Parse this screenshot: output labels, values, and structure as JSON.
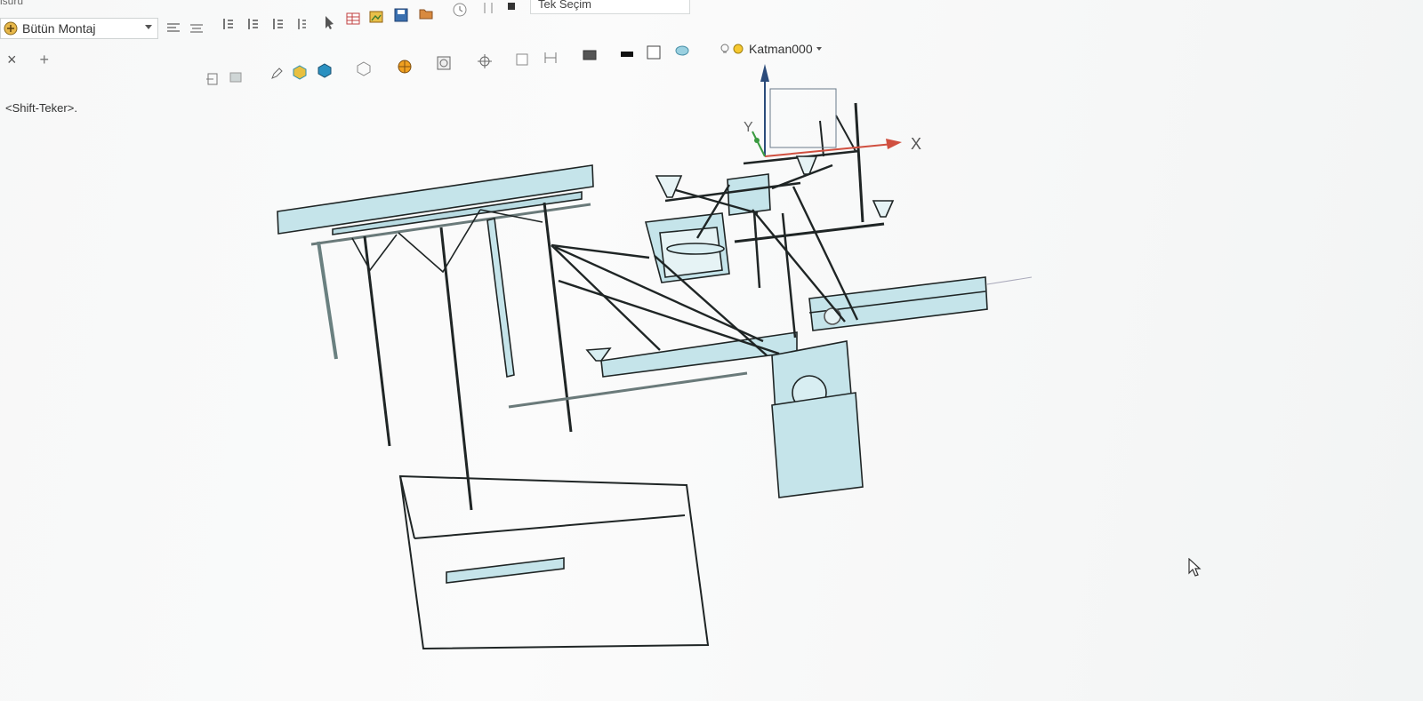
{
  "window": {
    "title_fragment": "isuru"
  },
  "toolbar": {
    "assembly_dropdown": {
      "value": "Bütün Montaj"
    },
    "selection_mode": {
      "value": "Tek Seçim"
    },
    "layer_dropdown": {
      "value": "Katman000"
    },
    "icons": [
      "align-icon",
      "align-icon",
      "list-indent-icon",
      "list-indent-icon",
      "list-indent-icon",
      "list-indent-icon",
      "cursor-icon",
      "table-icon",
      "image-icon",
      "save-icon",
      "folder-icon",
      "clock-icon"
    ]
  },
  "tabs": {
    "close_label": "×",
    "add_label": "+"
  },
  "viewport": {
    "hint": "<Shift-Teker>.",
    "axis_x_label": "X",
    "axis_y_label": "Y",
    "model_color": "#c5e4ea",
    "line_color": "#1f2525"
  }
}
